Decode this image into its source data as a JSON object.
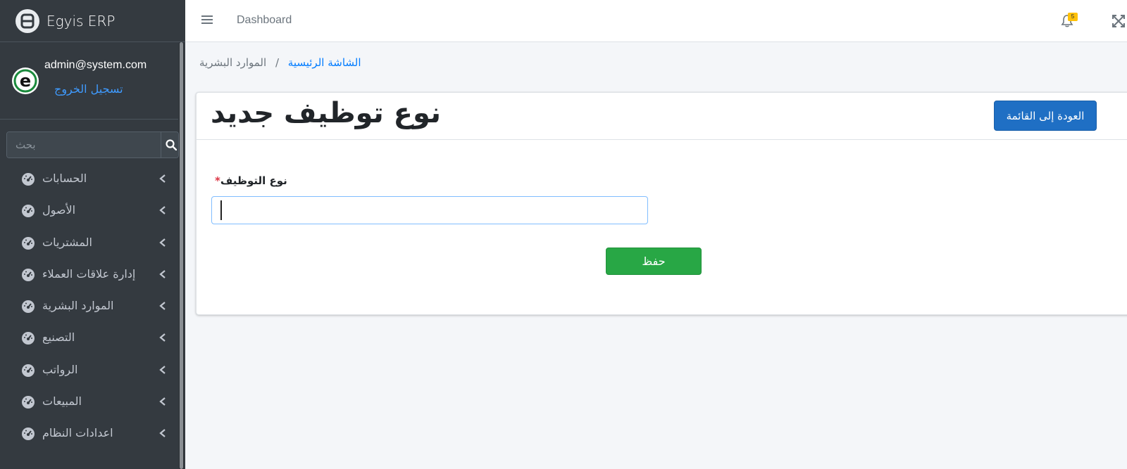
{
  "brand": {
    "title": "Egyis ERP"
  },
  "user": {
    "email": "admin@system.com",
    "logout_label": "تسجيل الخروج"
  },
  "search": {
    "placeholder": "بحث"
  },
  "sidebar": {
    "items": [
      {
        "label": "الحسابات"
      },
      {
        "label": "الأصول"
      },
      {
        "label": "المشتريات"
      },
      {
        "label": "إدارة علاقات العملاء"
      },
      {
        "label": "الموارد البشرية"
      },
      {
        "label": "التصنيع"
      },
      {
        "label": "الرواتب"
      },
      {
        "label": "المبيعات"
      },
      {
        "label": "اعدادات النظام"
      }
    ]
  },
  "topbar": {
    "dashboard_label": "Dashboard",
    "notification_count": "5"
  },
  "breadcrumb": {
    "home": "الشاشة الرئيسية",
    "separator": "/",
    "current": "الموارد البشرية"
  },
  "card": {
    "title": "نوع توظيف جديد",
    "back_button": "العودة إلى القائمة",
    "field_label": "نوع التوظيف",
    "required_mark": "*",
    "field_value": "",
    "save_button": "حفظ"
  },
  "colors": {
    "sidebar_bg": "#343a40",
    "primary": "#1f6fc4",
    "success": "#28a745",
    "link": "#007bff",
    "badge": "#ffc107"
  }
}
